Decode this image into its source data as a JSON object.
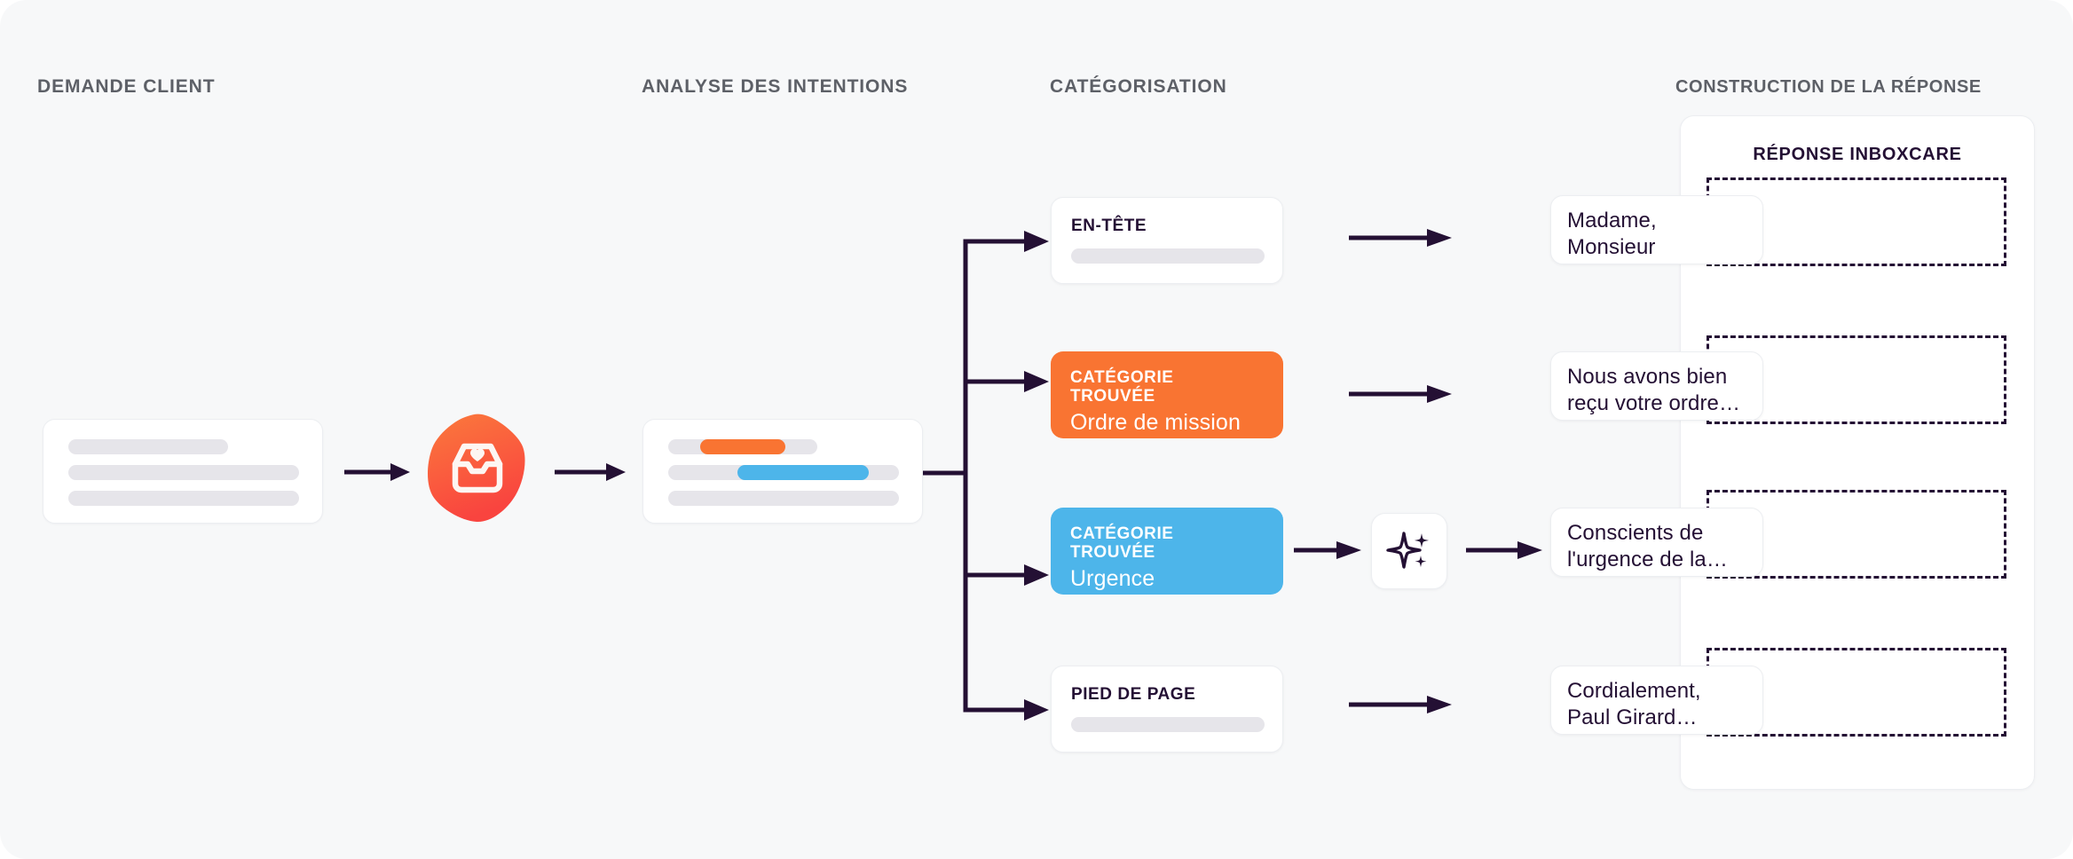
{
  "columns": [
    {
      "id": "demande",
      "label": "DEMANDE CLIENT"
    },
    {
      "id": "analyse",
      "label": "ANALYSE DES INTENTIONS"
    },
    {
      "id": "categorisation",
      "label": "CATÉGORISATION"
    },
    {
      "id": "construction",
      "label": "CONSTRUCTION DE LA RÉPONSE"
    }
  ],
  "client_request": {
    "name": "client-request-card",
    "lines": 3
  },
  "logo": {
    "icon": "inbox-heart-icon",
    "gradient_from": "#fb7a3c",
    "gradient_to": "#f9443f"
  },
  "intent_analysis": {
    "name": "intent-analysis-card",
    "highlights": [
      {
        "color": "#f97432",
        "label": "orange-intent-highlight"
      },
      {
        "color": "#4db5ea",
        "label": "blue-intent-highlight"
      }
    ]
  },
  "categories": [
    {
      "id": "en-tete",
      "kicker": "EN-TÊTE",
      "value": "",
      "style": "plain",
      "color": "#ffffff"
    },
    {
      "id": "ordre",
      "kicker": "CATÉGORIE TROUVÉE",
      "value": "Ordre de mission",
      "style": "orange",
      "color": "#f97432"
    },
    {
      "id": "urgence",
      "kicker": "CATÉGORIE TROUVÉE",
      "value": "Urgence",
      "style": "blue",
      "color": "#4db5ea"
    },
    {
      "id": "pied",
      "kicker": "PIED DE PAGE",
      "value": "",
      "style": "plain",
      "color": "#ffffff"
    }
  ],
  "ai_button": {
    "icon": "sparkles-icon",
    "label": ""
  },
  "response_panel": {
    "title": "RÉPONSE INBOXCARE",
    "slots": 4
  },
  "responses": [
    {
      "id": "salutation",
      "text": "Madame,\nMonsieur"
    },
    {
      "id": "accuse",
      "text": "Nous avons bien\nreçu votre ordre…"
    },
    {
      "id": "urgence",
      "text": "Conscients de\nl'urgence de la…"
    },
    {
      "id": "signature",
      "text": "Cordialement,\nPaul Girard…"
    }
  ],
  "theme": {
    "background": "#f7f8f9",
    "ink": "#241034",
    "muted": "#5d6067",
    "skeleton": "#e6e5ea",
    "accent_orange": "#f97432",
    "accent_blue": "#4db5ea"
  }
}
